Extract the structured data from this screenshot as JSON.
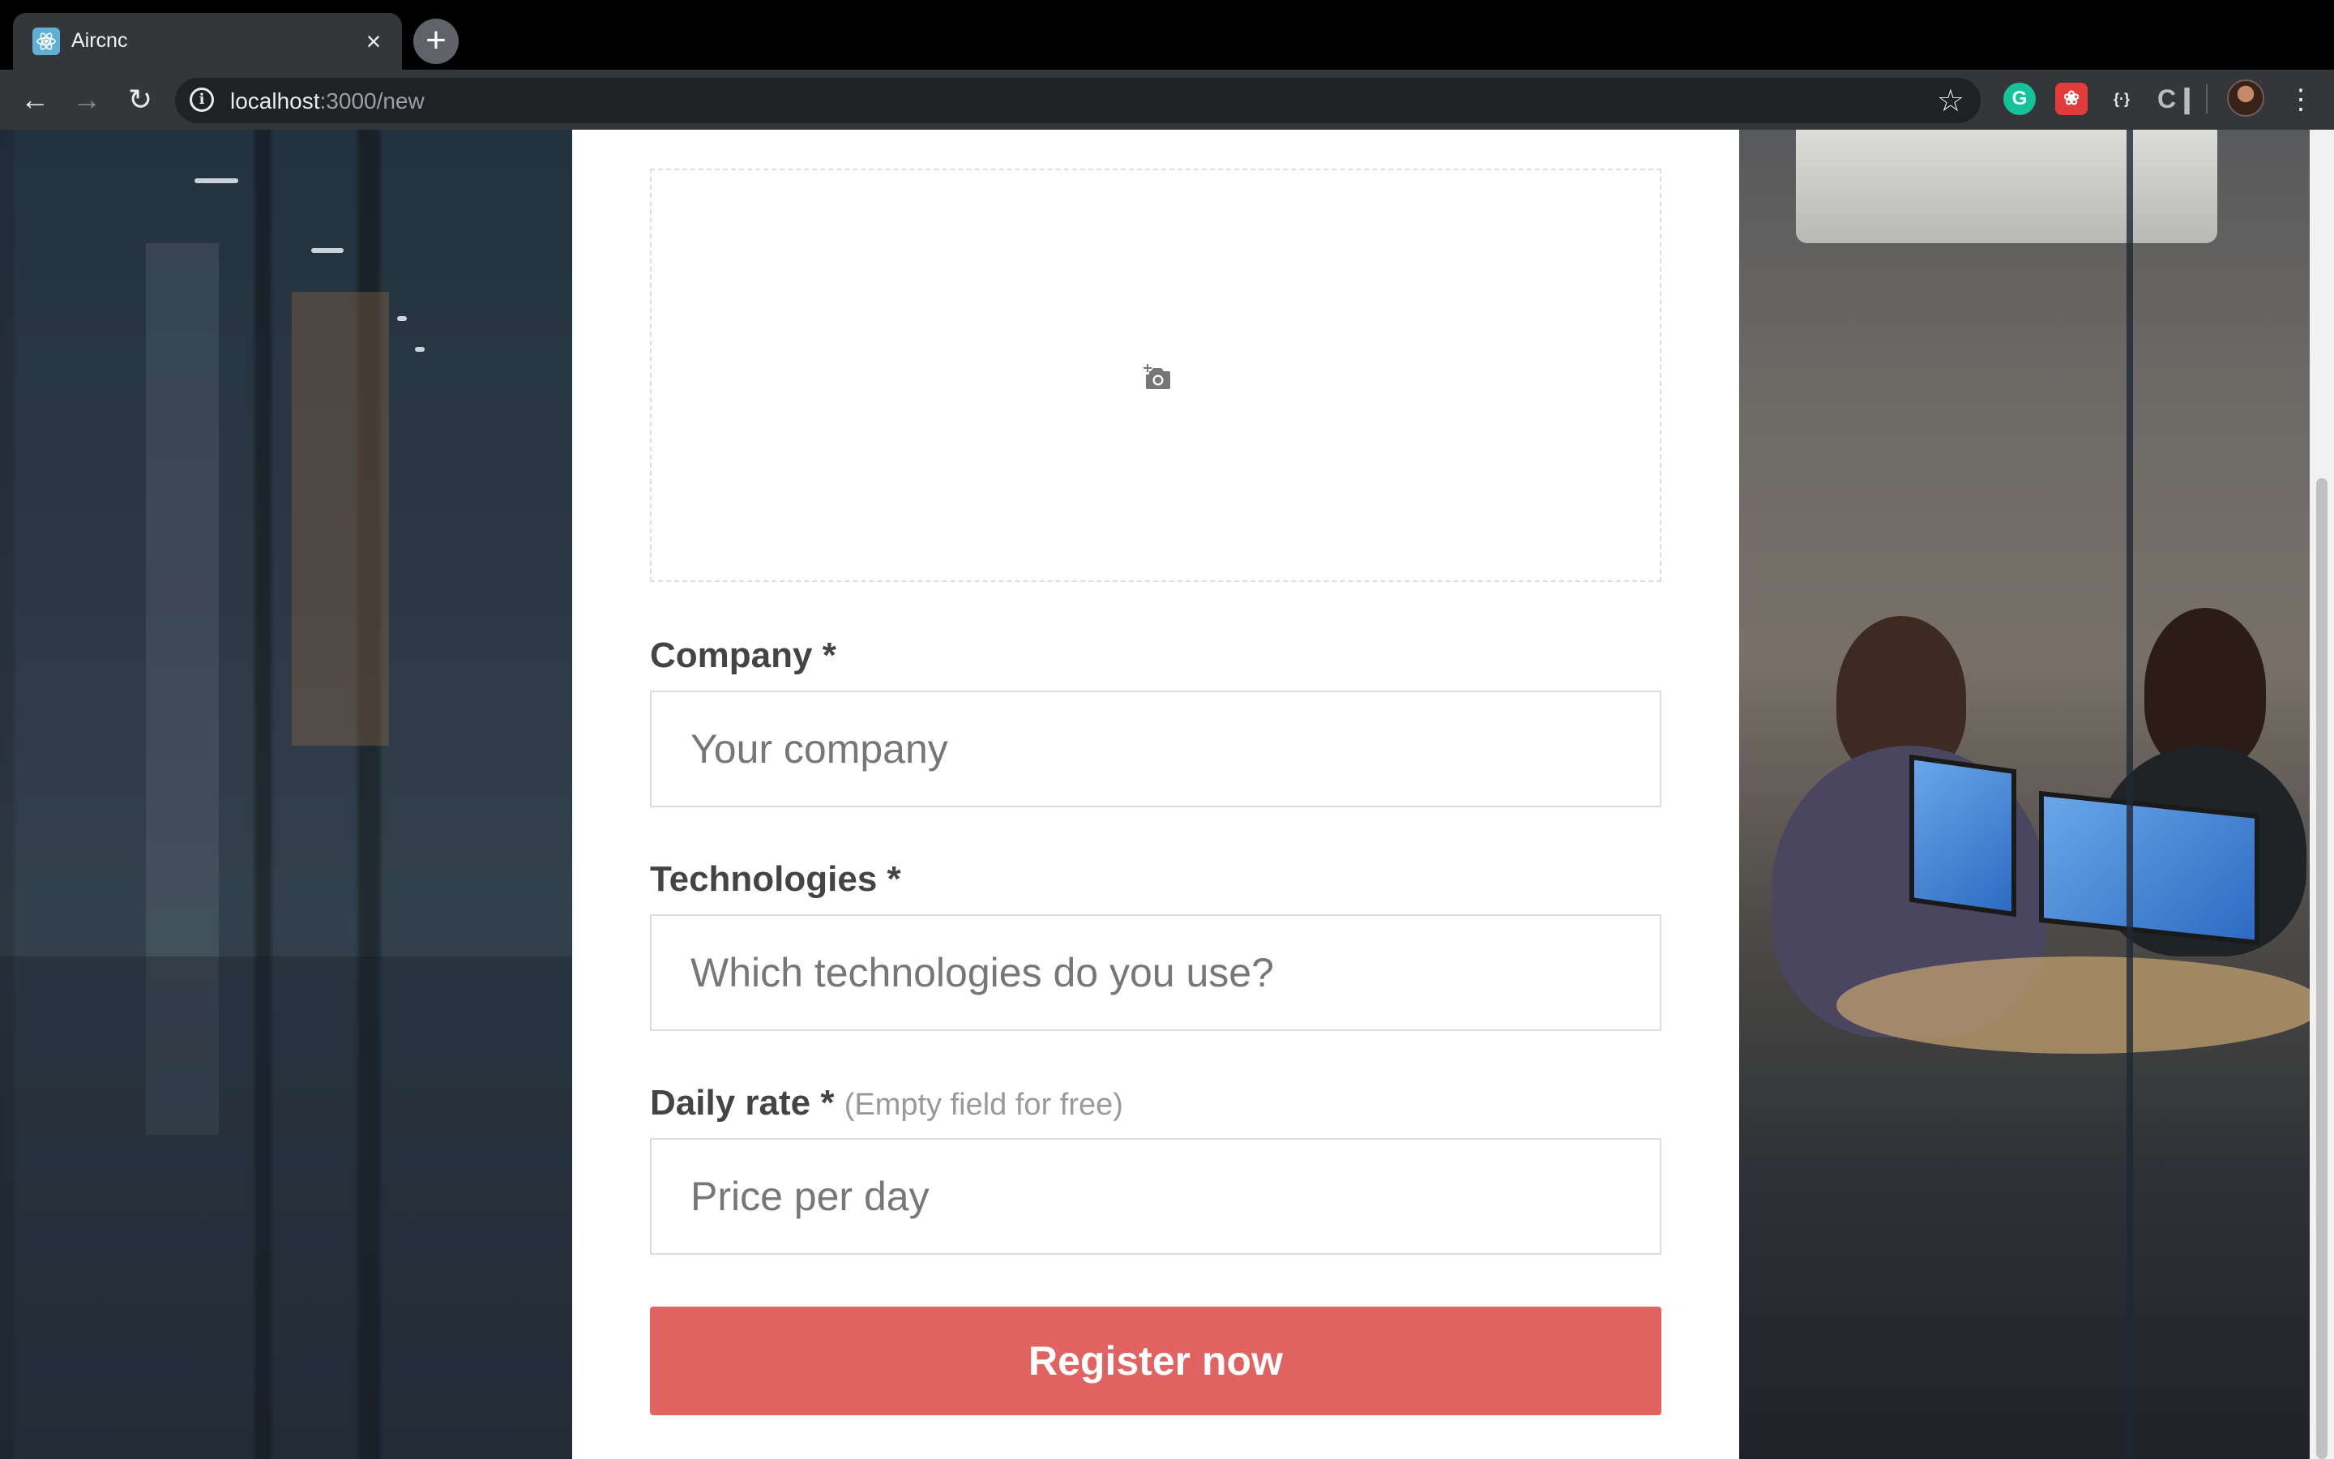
{
  "browser": {
    "tab": {
      "title": "Aircnc",
      "favicon": "react-icon",
      "close_icon": "close-icon"
    },
    "new_tab_icon": "plus-icon",
    "url_host": "localhost",
    "url_path": ":3000/new",
    "icons": {
      "back": "back-arrow-icon",
      "forward": "forward-arrow-icon",
      "reload": "reload-icon",
      "info": "info-icon",
      "bookmark": "star-icon",
      "menu": "kebab-menu-icon"
    },
    "extensions": [
      {
        "name": "grammarly-extension-icon",
        "glyph": "G"
      },
      {
        "name": "red-extension-icon",
        "glyph": "❀"
      },
      {
        "name": "json-viewer-extension-icon",
        "glyph": "{·}"
      },
      {
        "name": "c-extension-icon",
        "glyph": "C❙"
      }
    ]
  },
  "form": {
    "upload_icon": "add-photo-camera-icon",
    "company": {
      "label": "Company *",
      "placeholder": "Your company"
    },
    "technologies": {
      "label": "Technologies *",
      "placeholder": "Which technologies do you use?"
    },
    "daily_rate": {
      "label": "Daily rate *",
      "hint": "(Empty field for free)",
      "placeholder": "Price per day"
    },
    "submit_label": "Register now"
  },
  "colors": {
    "accent": "#e06361",
    "label": "#444444",
    "hint": "#999999",
    "border": "#dddddd",
    "chrome_dark": "#35363a"
  }
}
